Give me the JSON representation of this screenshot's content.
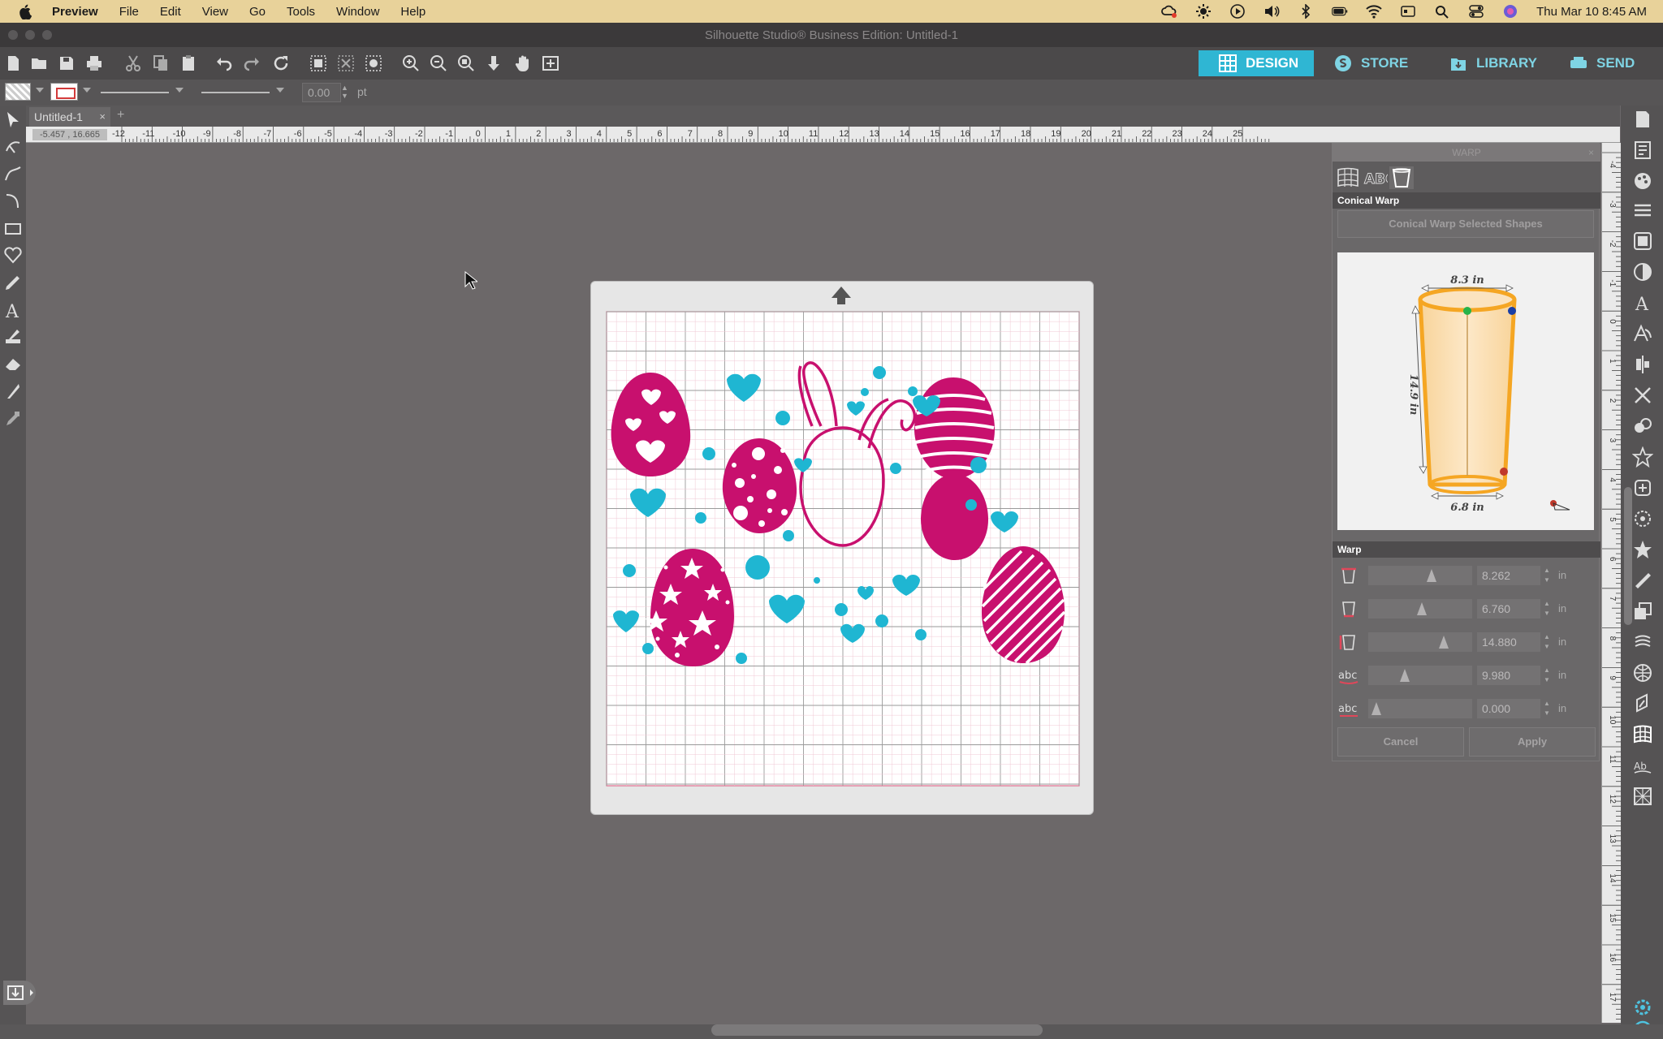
{
  "menubar": {
    "app_name": "Preview",
    "items": [
      "File",
      "Edit",
      "View",
      "Go",
      "Tools",
      "Window",
      "Help"
    ],
    "datetime": "Thu Mar 10  8:45 AM"
  },
  "window": {
    "title": "Silhouette Studio® Business Edition: Untitled-1"
  },
  "nav_tabs": [
    {
      "label": "DESIGN",
      "icon": "grid-icon",
      "active": true
    },
    {
      "label": "STORE",
      "icon": "store-icon",
      "active": false
    },
    {
      "label": "LIBRARY",
      "icon": "library-icon",
      "active": false
    },
    {
      "label": "SEND",
      "icon": "send-icon",
      "active": false
    }
  ],
  "line_options": {
    "line_width_value": "0.00",
    "line_width_unit": "pt"
  },
  "document": {
    "tab_label": "Untitled-1",
    "close_glyph": "×",
    "new_tab_glyph": "+"
  },
  "ruler": {
    "coordinate_readout": "-5.457 , 16.665",
    "h_ticks": [
      "-12",
      "-11",
      "-10",
      "-9",
      "-8",
      "-7",
      "-6",
      "-5",
      "-4",
      "-3",
      "-2",
      "-1",
      "0",
      "1",
      "2",
      "3",
      "4",
      "5",
      "6",
      "7",
      "8",
      "9",
      "10",
      "11",
      "12",
      "13",
      "14",
      "15",
      "16",
      "17",
      "18",
      "19",
      "20",
      "21",
      "22",
      "23",
      "24",
      "25"
    ],
    "v_ticks": [
      "-4",
      "-3",
      "-2",
      "-1",
      "0",
      "1",
      "2",
      "3",
      "4",
      "5",
      "6",
      "7",
      "8",
      "9",
      "10",
      "11",
      "12",
      "13",
      "14",
      "15",
      "16",
      "17"
    ]
  },
  "warp_panel": {
    "title": "WARP",
    "section_conical": "Conical Warp",
    "conical_button": "Conical Warp Selected Shapes",
    "diagram": {
      "top_width": "8.3 in",
      "height": "14.9 in",
      "bottom_width": "6.8 in"
    },
    "section_warp": "Warp",
    "rows": [
      {
        "icon": "cup-top-width-icon",
        "value": "8.262",
        "unit": "in",
        "slider_fraction": 0.62
      },
      {
        "icon": "cup-bottom-width-icon",
        "value": "6.760",
        "unit": "in",
        "slider_fraction": 0.51
      },
      {
        "icon": "cup-height-icon",
        "value": "14.880",
        "unit": "in",
        "slider_fraction": 0.75
      },
      {
        "icon": "abc-arc-icon",
        "value": "9.980",
        "unit": "in",
        "slider_fraction": 0.32
      },
      {
        "icon": "abc-offset-icon",
        "value": "0.000",
        "unit": "in",
        "slider_fraction": 0.0
      }
    ],
    "cancel_label": "Cancel",
    "apply_label": "Apply"
  },
  "colors": {
    "accent": "#2fb6d3",
    "egg_pink": "#c8106e",
    "heart_blue": "#1fb6d2",
    "cup_orange": "#f5a623"
  }
}
